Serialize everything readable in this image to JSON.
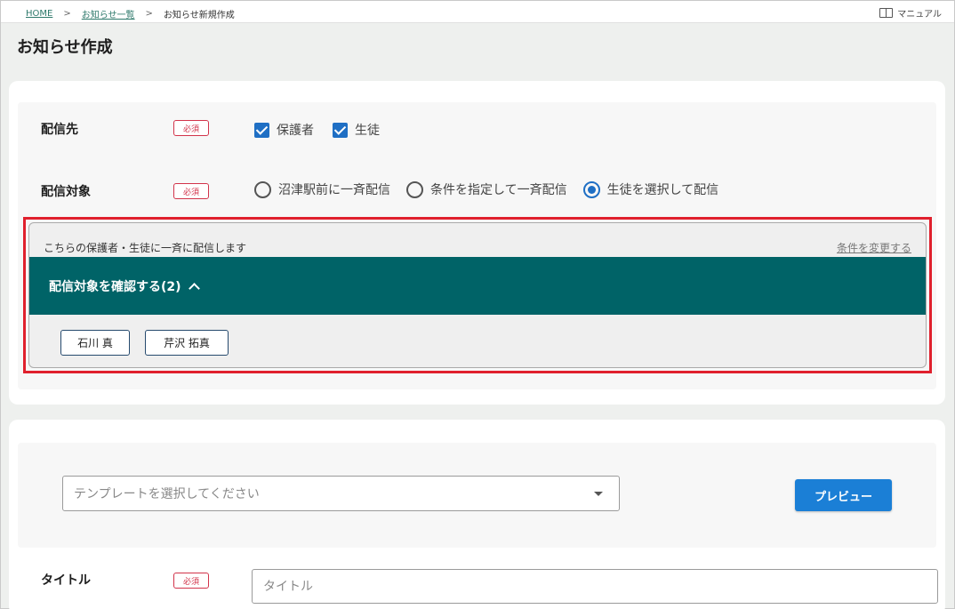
{
  "breadcrumb": {
    "home": "HOME",
    "separator": ">",
    "list": "お知らせ一覧",
    "current": "お知らせ新規作成"
  },
  "manual": {
    "label": "マニュアル",
    "icon": "book-icon"
  },
  "page_title": "お知らせ作成",
  "recipients": {
    "label": "配信先",
    "required": "必須",
    "options": [
      {
        "label": "保護者",
        "checked": true
      },
      {
        "label": "生徒",
        "checked": true
      }
    ]
  },
  "target": {
    "label": "配信対象",
    "required": "必須",
    "options": [
      {
        "label": "沼津駅前に一斉配信",
        "selected": false
      },
      {
        "label": "条件を指定して一斉配信",
        "selected": false
      },
      {
        "label": "生徒を選択して配信",
        "selected": true
      }
    ]
  },
  "target_panel": {
    "note": "こちらの保護者・生徒に一斉に配信します",
    "change_link": "条件を変更する",
    "confirm_label": "配信対象を確認する(2)",
    "students": [
      "石川 真",
      "芹沢 拓真"
    ]
  },
  "template": {
    "placeholder": "テンプレートを選択してください",
    "preview_button": "プレビュー"
  },
  "title_field": {
    "label": "タイトル",
    "required": "必須",
    "placeholder": "タイトル"
  },
  "colors": {
    "accent_teal": "#006367",
    "primary_blue": "#1b7fd6",
    "required_red": "#d2334a",
    "highlight_red": "#e0202d"
  }
}
